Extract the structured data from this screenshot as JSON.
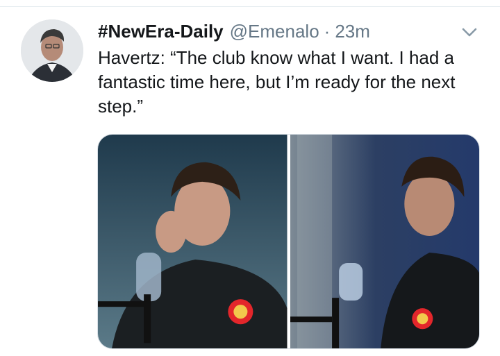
{
  "tweet": {
    "display_name": "#NewEra-Daily",
    "handle": "@Emenalo",
    "separator": "·",
    "time": "23m",
    "text": "Havertz: “The club know what I want. I had a fantastic time here, but I’m ready for the next step.”"
  },
  "icons": {
    "menu": "chevron-down-icon"
  },
  "colors": {
    "text": "#14171a",
    "secondary": "#657786",
    "border": "#e6ecf0"
  },
  "media": {
    "count": 2
  }
}
